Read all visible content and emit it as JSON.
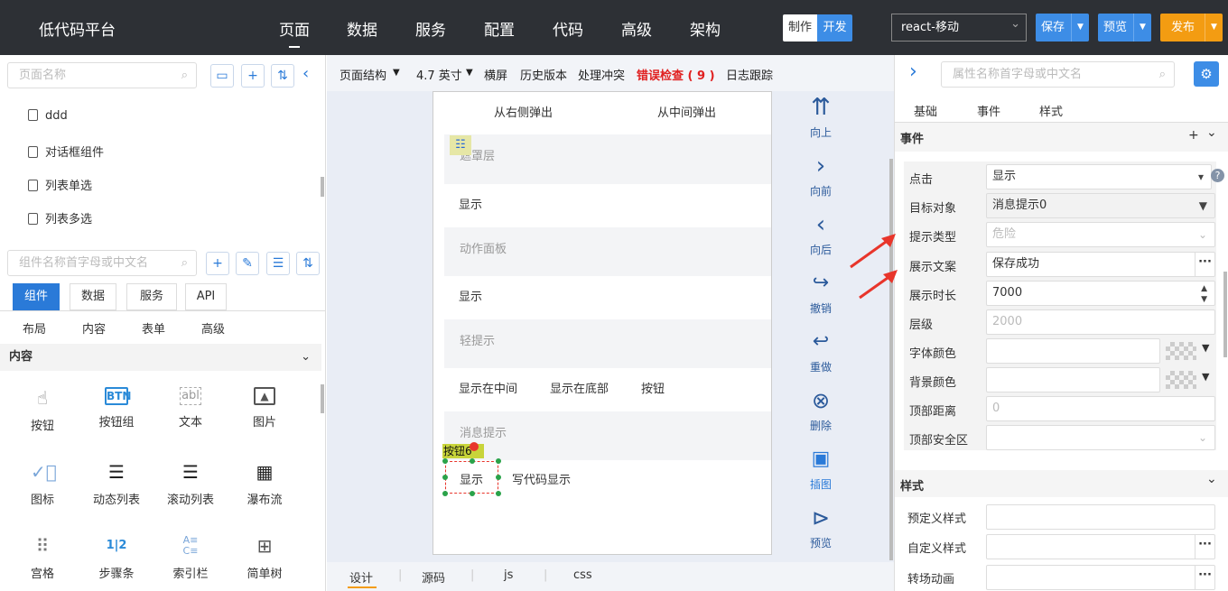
{
  "topbar": {
    "logo": "低代码平台",
    "nav": [
      "页面",
      "数据",
      "服务",
      "配置",
      "代码",
      "高级",
      "架构"
    ],
    "mode": {
      "make": "制作",
      "dev": "开发"
    },
    "app_select": "react-移动",
    "save": "保存",
    "preview": "预览",
    "publish": "发布"
  },
  "left": {
    "page_search_placeholder": "页面名称",
    "pages": [
      "ddd",
      "对话框组件",
      "列表单选",
      "列表多选"
    ],
    "comp_search_placeholder": "组件名称首字母或中文名",
    "tabs": [
      "组件",
      "数据",
      "服务",
      "API"
    ],
    "subtabs": [
      "布局",
      "内容",
      "表单",
      "高级"
    ],
    "section": "内容",
    "components": [
      {
        "label": "按钮",
        "icon": "hand-pointer-icon"
      },
      {
        "label": "按钮组",
        "icon": "button-group-icon"
      },
      {
        "label": "文本",
        "icon": "text-icon"
      },
      {
        "label": "图片",
        "icon": "image-icon"
      },
      {
        "label": "图标",
        "icon": "check-circle-icon"
      },
      {
        "label": "动态列表",
        "icon": "list-icon"
      },
      {
        "label": "滚动列表",
        "icon": "list-icon"
      },
      {
        "label": "瀑布流",
        "icon": "waterfall-icon"
      },
      {
        "label": "宫格",
        "icon": "grid-icon"
      },
      {
        "label": "步骤条",
        "icon": "steps-icon"
      },
      {
        "label": "索引栏",
        "icon": "index-bar-icon"
      },
      {
        "label": "简单树",
        "icon": "tree-icon"
      }
    ]
  },
  "center": {
    "toolbar": {
      "structure": "页面结构",
      "size": "4.7 英寸",
      "landscape": "横屏",
      "history": "历史版本",
      "conflict": "处理冲突",
      "error_check": "错误检查 ( 9 )",
      "log": "日志跟踪"
    },
    "phone": {
      "row_popup": [
        "从右侧弹出",
        "从中间弹出"
      ],
      "group_mask": "遮罩层",
      "mask_show": "显示",
      "group_action": "动作面板",
      "action_show": "显示",
      "group_toast": "轻提示",
      "toast_items": [
        "显示在中间",
        "显示在底部",
        "按钮"
      ],
      "group_message": "消息提示",
      "selected_tag": "按钮6",
      "message_items": [
        "显示",
        "写代码显示"
      ]
    },
    "actions": [
      "向上",
      "向前",
      "向后",
      "撤销",
      "重做",
      "删除",
      "插图",
      "预览"
    ],
    "bottom_tabs": [
      "设计",
      "源码",
      "js",
      "css"
    ]
  },
  "right": {
    "search_placeholder": "属性名称首字母或中文名",
    "tabs": [
      "基础",
      "事件",
      "样式"
    ],
    "events_section": "事件",
    "props": [
      {
        "label": "点击",
        "value": "显示"
      },
      {
        "label": "目标对象",
        "value": "消息提示0"
      },
      {
        "label": "提示类型",
        "value": "危险"
      },
      {
        "label": "展示文案",
        "value": "保存成功"
      },
      {
        "label": "展示时长",
        "value": "7000"
      },
      {
        "label": "层级",
        "value": "2000"
      },
      {
        "label": "字体颜色",
        "value": ""
      },
      {
        "label": "背景颜色",
        "value": ""
      },
      {
        "label": "顶部距离",
        "value": "0"
      },
      {
        "label": "顶部安全区",
        "value": ""
      }
    ],
    "style_section": "样式",
    "style_props": [
      "预定义样式",
      "自定义样式",
      "转场动画"
    ]
  },
  "colors": {
    "accent": "#2a7ad8",
    "topbar": "#2d3035",
    "publish": "#f39c12",
    "error": "#e02020",
    "arrow": "#e8352b"
  }
}
